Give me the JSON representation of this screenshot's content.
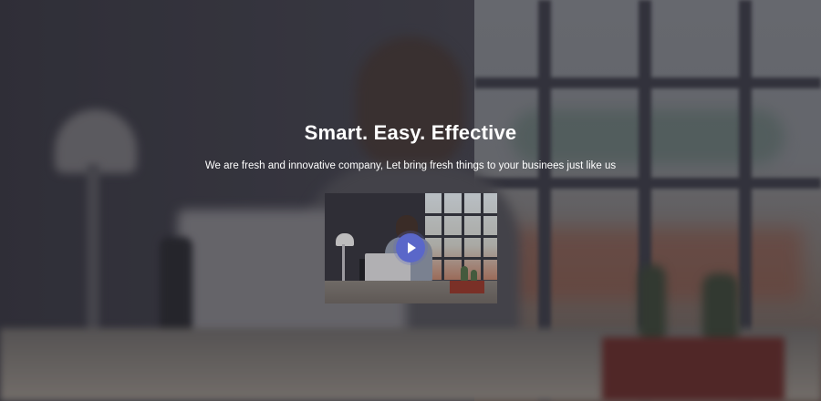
{
  "hero": {
    "title": "Smart. Easy. Effective",
    "subtitle": "We are fresh and innovative company, Let bring fresh things to your businees just like us"
  },
  "video": {
    "play_icon": "play-icon"
  },
  "colors": {
    "accent": "#5a67c9",
    "text": "#ffffff",
    "overlay": "#2b2b35"
  }
}
